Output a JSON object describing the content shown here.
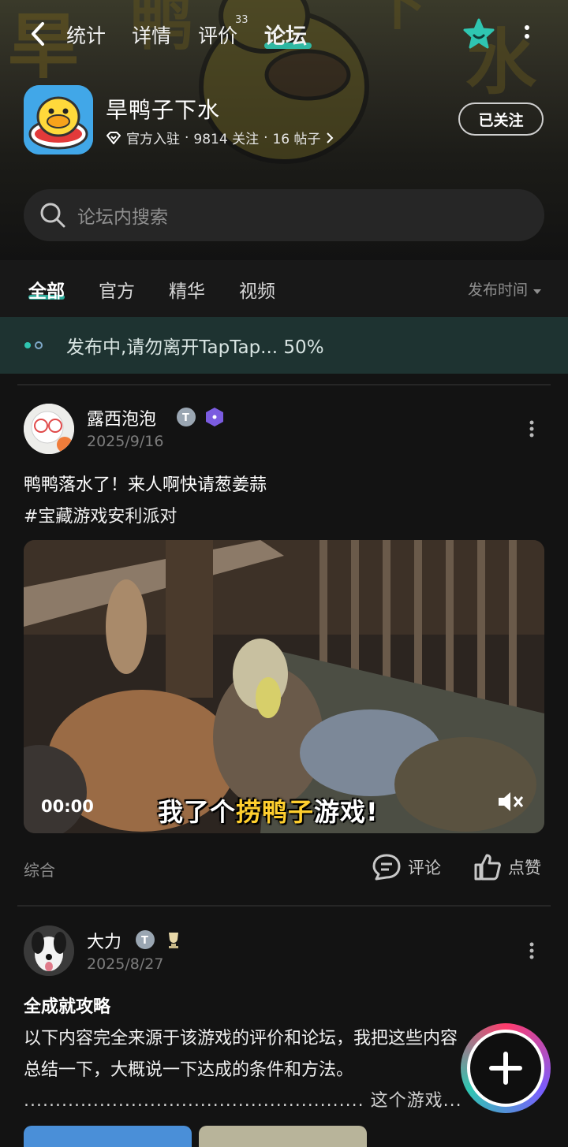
{
  "nav": {
    "tabs": [
      {
        "label": "统计"
      },
      {
        "label": "详情"
      },
      {
        "label": "评价",
        "badge": "33"
      },
      {
        "label": "论坛"
      }
    ],
    "active_tab": "论坛",
    "accent_color": "#2fc6b1"
  },
  "app": {
    "name": "旱鸭子下水",
    "official_label": "官方入驻",
    "followers": "9814 关注",
    "posts": "16 帖子",
    "follow_button": "已关注",
    "separator": "·"
  },
  "search": {
    "placeholder": "论坛内搜索"
  },
  "filters": {
    "tabs": [
      "全部",
      "官方",
      "精华",
      "视频"
    ],
    "active": "全部",
    "sort_label": "发布时间"
  },
  "upload": {
    "text": "发布中,请勿离开TapTap... 50%"
  },
  "posts": [
    {
      "author": "露西泡泡",
      "date": "2025/9/16",
      "title": "鸭鸭落水了！来人啊快请葱姜蒜",
      "tag": "#宝藏游戏安利派对",
      "video": {
        "time": "00:00",
        "subtitle_pre": "我了个",
        "subtitle_hl": "捞鸭子",
        "subtitle_post": "游戏!"
      },
      "category": "综合",
      "comment_label": "评论",
      "like_label": "点赞"
    },
    {
      "author": "大力",
      "date": "2025/8/27",
      "title": "全成就攻略",
      "body_line1": "以下内容完全来源于该游戏的评价和论坛，我把这些内容",
      "body_line2": "总结一下，大概说一下达成的条件和方法。",
      "body_line3": "...................................................... 这个游戏..."
    }
  ],
  "icons": {
    "back": "chevron-left-icon",
    "star": "star-icon",
    "more": "more-vertical-icon",
    "search": "search-icon",
    "comment": "comment-icon",
    "like": "thumbs-up-icon",
    "mute": "mute-icon",
    "fab": "plus-icon"
  }
}
